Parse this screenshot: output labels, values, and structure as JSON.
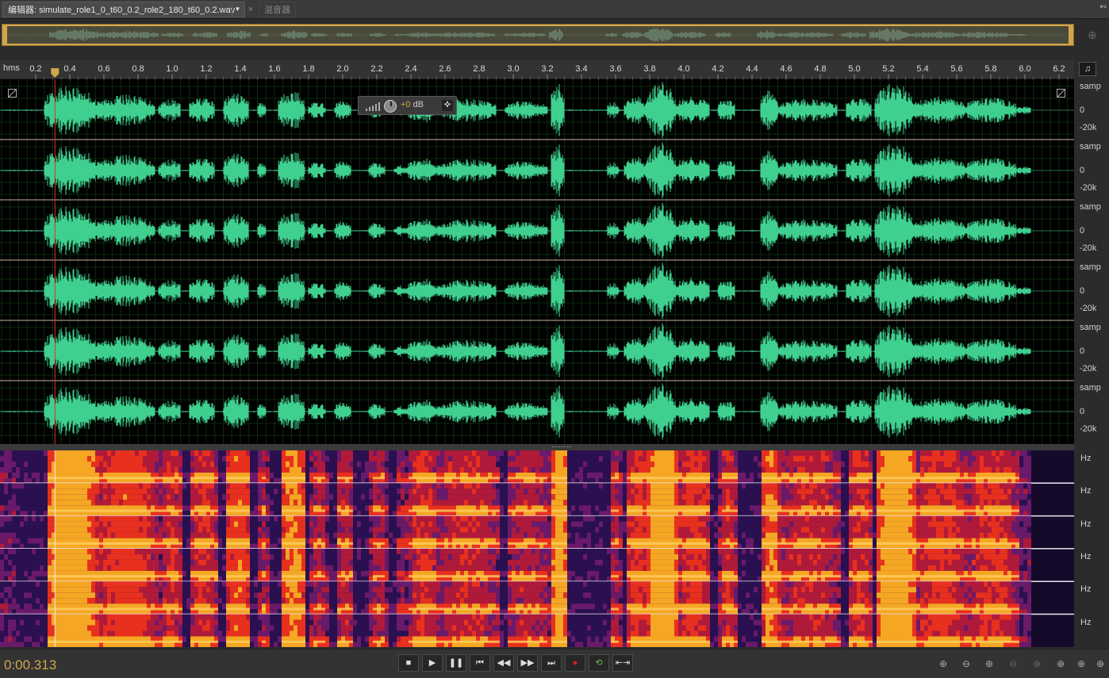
{
  "tabs": {
    "editor_label": "编辑器: simulate_role1_0_t60_0.2_role2_180_t60_0.2.wav",
    "dropdown_icon": "chevron-down-icon",
    "close_glyph": "×",
    "mixer_label": "混音器",
    "panel_menu_glyph": "▾≡"
  },
  "ruler": {
    "unit_label": "hms",
    "ticks": [
      "0.2",
      "0.4",
      "0.6",
      "0.8",
      "1.0",
      "1.2",
      "1.4",
      "1.6",
      "1.8",
      "2.0",
      "2.2",
      "2.4",
      "2.6",
      "2.8",
      "3.0",
      "3.2",
      "3.4",
      "3.6",
      "3.8",
      "4.0",
      "4.2",
      "4.4",
      "4.6",
      "4.8",
      "5.0",
      "5.2",
      "5.4",
      "5.6",
      "5.8",
      "6.0",
      "6.2"
    ],
    "playhead_seconds": 0.313
  },
  "hud": {
    "volume_value": "+0",
    "volume_unit": "dB"
  },
  "waveform": {
    "channel_count": 6,
    "color": "#3fd08f",
    "amp_labels": [
      "samp",
      "0",
      "-20k"
    ]
  },
  "spectral": {
    "hz_label": "Hz"
  },
  "transport": {
    "current_time": "0:00.313",
    "buttons": [
      "stop-icon",
      "play-icon",
      "pause-icon",
      "go-to-start-icon",
      "rewind-icon",
      "fast-forward-icon",
      "go-to-end-icon",
      "record-icon",
      "loop-icon",
      "skip-selection-icon"
    ],
    "zoom_buttons": [
      "zoom-in-amplitude-icon",
      "zoom-out-amplitude-icon",
      "zoom-in-time-icon",
      "zoom-out-time-icon",
      "zoom-full-icon",
      "zoom-in-selection-icon",
      "zoom-in-left-icon",
      "zoom-in-right-icon",
      "zoom-out-full-icon"
    ]
  },
  "colors": {
    "accent": "#d1a64a",
    "wave": "#3fd08f",
    "playhead": "#e0302a",
    "grid": "#1c3a1c"
  }
}
